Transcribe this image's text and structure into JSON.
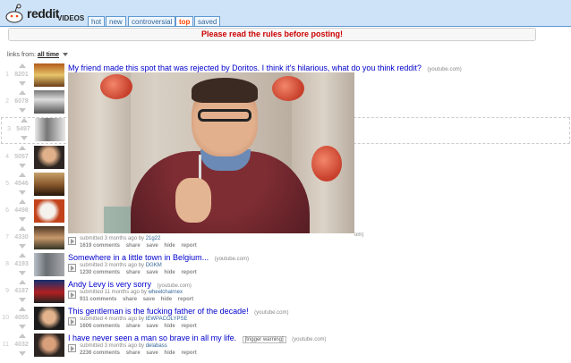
{
  "header": {
    "logo_text": "reddit",
    "subreddit": "VIDEOS",
    "tabs": [
      {
        "label": "hot"
      },
      {
        "label": "new"
      },
      {
        "label": "controversial"
      },
      {
        "label": "top"
      },
      {
        "label": "saved"
      }
    ],
    "active_tab": "top"
  },
  "announcement": "Please read the rules before posting!",
  "menu": {
    "prefix": "links from:",
    "selected": "all time"
  },
  "posts": [
    {
      "rank": "1",
      "score": "8201",
      "title": "My friend made this spot that was rejected by Doritos. I think it's hilarious, what do you think reddit?",
      "domain": "(youtube.com)"
    },
    {
      "rank": "2",
      "score": "6078"
    },
    {
      "rank": "3",
      "score": "5497"
    },
    {
      "rank": "4",
      "score": "5057"
    },
    {
      "rank": "5",
      "score": "4546"
    },
    {
      "rank": "6",
      "score": "4498"
    },
    {
      "rank": "7",
      "score": "4330",
      "domain_tail": "om)",
      "tagline_prefix": "submitted 3 months ago by",
      "author": "21g22",
      "comments": "1619 comments"
    },
    {
      "rank": "8",
      "score": "4193",
      "title": "Somewhere in a little town in Belgium...",
      "domain": "(youtube.com)",
      "tagline_prefix": "submitted 3 months ago by",
      "author": "DGKM",
      "comments": "1230 comments"
    },
    {
      "rank": "9",
      "score": "4187",
      "title": "Andy Levy is very sorry",
      "domain": "(youtube.com)",
      "tagline_prefix": "submitted 11 months ago by",
      "author": "wheelchairnex",
      "comments": "911 comments"
    },
    {
      "rank": "10",
      "score": "4055",
      "title": "This gentleman is the fucking father of the decade!",
      "domain": "(youtube.com)",
      "tagline_prefix": "submitted 4 months ago by",
      "author": "IEWPACOLYPSE",
      "comments": "1606 comments"
    },
    {
      "rank": "11",
      "score": "4032",
      "title": "I have never seen a man so brave in all my life.",
      "flair": "[trigger warning]",
      "domain": "(youtube.com)",
      "tagline_prefix": "submitted 3 months ago by",
      "author": "delabass",
      "comments": "2236 comments"
    }
  ],
  "actions": {
    "share": "share",
    "save": "save",
    "hide": "hide",
    "report": "report"
  }
}
